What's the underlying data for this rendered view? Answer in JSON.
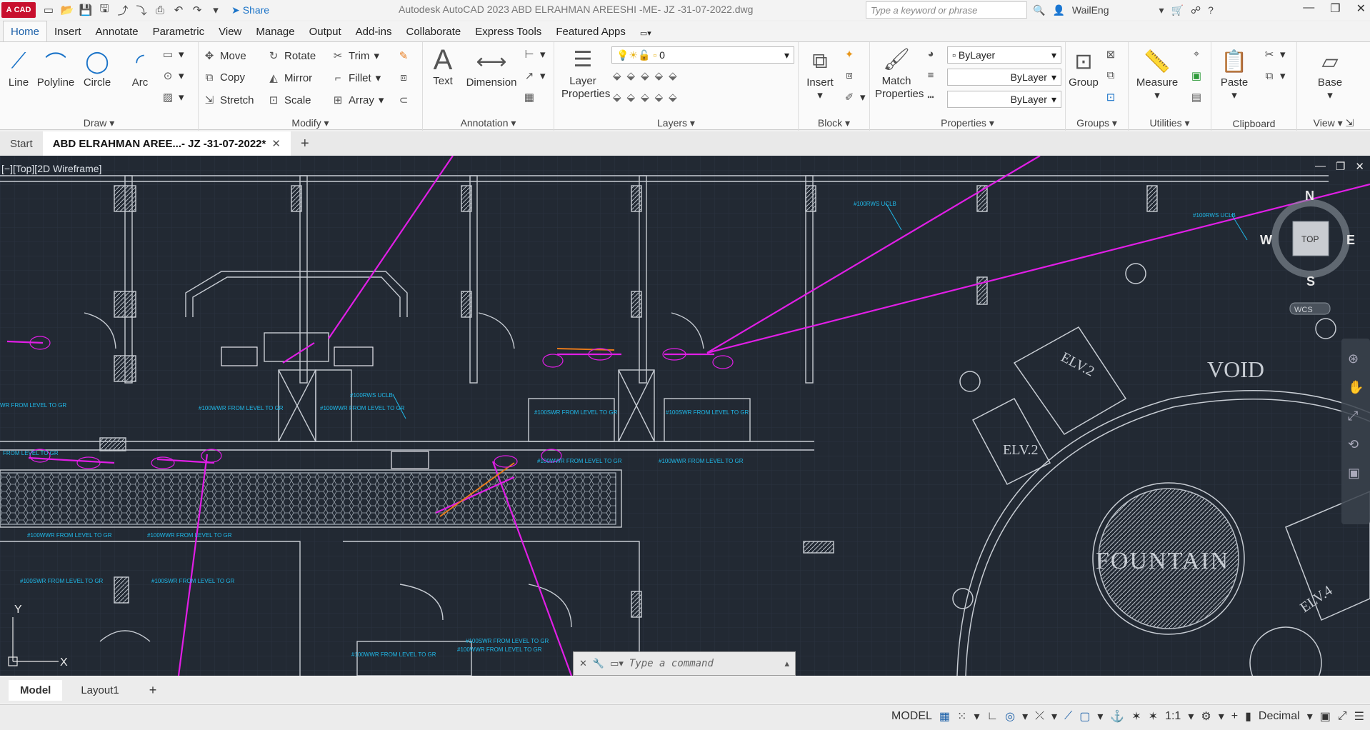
{
  "titlebar": {
    "app_badge": "CAD",
    "share_label": "Share",
    "window_title": "Autodesk AutoCAD 2023    ABD ELRAHMAN AREESHI -ME- JZ -31-07-2022.dwg",
    "search_placeholder": "Type a keyword or phrase",
    "user": "WailEng"
  },
  "ribbon_tabs": [
    "Home",
    "Insert",
    "Annotate",
    "Parametric",
    "View",
    "Manage",
    "Output",
    "Add-ins",
    "Collaborate",
    "Express Tools",
    "Featured Apps"
  ],
  "ribbon": {
    "draw": {
      "title": "Draw",
      "line": "Line",
      "polyline": "Polyline",
      "circle": "Circle",
      "arc": "Arc"
    },
    "modify": {
      "title": "Modify",
      "move": "Move",
      "rotate": "Rotate",
      "trim": "Trim",
      "copy": "Copy",
      "mirror": "Mirror",
      "fillet": "Fillet",
      "stretch": "Stretch",
      "scale": "Scale",
      "array": "Array"
    },
    "annotation": {
      "title": "Annotation",
      "text": "Text",
      "dimension": "Dimension"
    },
    "layers": {
      "title": "Layers",
      "layer_properties": "Layer Properties",
      "current_layer": "0"
    },
    "block": {
      "title": "Block",
      "insert": "Insert"
    },
    "properties": {
      "title": "Properties",
      "match": "Match Properties",
      "color": "ByLayer",
      "linetype": "ByLayer",
      "lineweight": "ByLayer"
    },
    "groups": {
      "title": "Groups",
      "group": "Group"
    },
    "utilities": {
      "title": "Utilities",
      "measure": "Measure"
    },
    "clipboard": {
      "title": "Clipboard",
      "paste": "Paste"
    },
    "view": {
      "title": "View",
      "base": "Base"
    }
  },
  "doc_tabs": {
    "start": "Start",
    "active": "ABD ELRAHMAN AREE...- JZ -31-07-2022*"
  },
  "viewport": {
    "label": "[−][Top][2D Wireframe]",
    "viewcube": {
      "n": "N",
      "s": "S",
      "e": "E",
      "w": "W",
      "top": "TOP",
      "wcs": "WCS"
    },
    "ucs": {
      "x": "X",
      "y": "Y"
    },
    "drawing_labels": {
      "void": "VOID",
      "fountain": "FOUNTAIN",
      "elv2a": "ELV.2",
      "elv2b": "ELV.2",
      "elv4": "ELV.4",
      "pipe1": "#100RWS UCLB",
      "pipe2": "#100RWS UCLB",
      "pipe3": "#100RWS UCLB",
      "n1": "#100WWR FROM LEVEL TO GR",
      "n2": "#100WWR FROM LEVEL TO GR",
      "n3": "#100SWR FROM LEVEL TO GR",
      "n4": "#100SWR FROM LEVEL TO GR",
      "n5": "#100WWR FROM LEVEL TO GR",
      "n6": "#100WWR FROM LEVEL TO GR",
      "n7": "#100WWR FROM LEVEL TO GR",
      "n8": "#100WWR FROM LEVEL TO GR",
      "n9": "#100SWR FROM LEVEL TO GR",
      "n10": "#100SWR FROM LEVEL TO GR",
      "n11": "#100WWR FROM LEVEL TO GR",
      "n12": "#100SWR FROM LEVEL TO GR",
      "n13": "#100WWR FROM LEVEL TO GR",
      "n14": "WR FROM LEVEL TO GR",
      "n15": "FROM LEVEL TO GR"
    }
  },
  "command_line": {
    "placeholder": "Type a command"
  },
  "layout_tabs": [
    "Model",
    "Layout1"
  ],
  "statusbar": {
    "model": "MODEL",
    "scale": "1:1",
    "units": "Decimal"
  },
  "colors": {
    "viewport_bg": "#222933",
    "pipe_magenta": "#e11ee6",
    "annot_cyan": "#20b8e8",
    "accent": "#1a5fa8"
  }
}
